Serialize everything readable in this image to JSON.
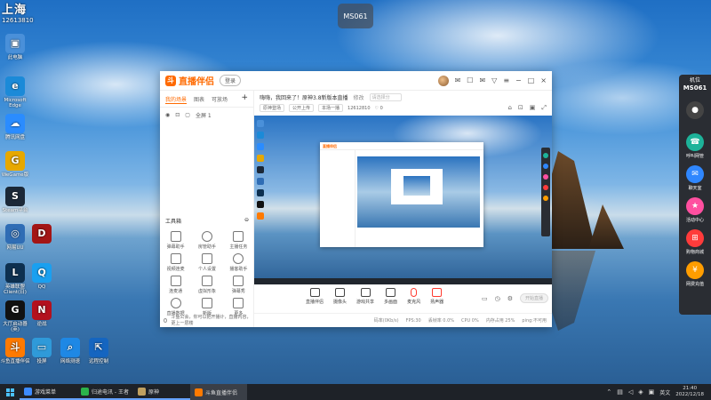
{
  "desktop": {
    "corner_label": "上海",
    "corner_sub": "12613810",
    "badge": "MS061",
    "icons": [
      {
        "label": "此电脑",
        "glyph": "▣",
        "color": "#4a90d9"
      },
      {
        "label": "Microsoft Edge",
        "glyph": "e",
        "color": "#1b8ad8"
      },
      {
        "label": "腾讯网盘",
        "glyph": "☁",
        "color": "#2a8cff"
      },
      {
        "label": "WeGame版",
        "glyph": "G",
        "color": "#e7a800"
      },
      {
        "label": "Steam平台",
        "glyph": "S",
        "color": "#1b2838"
      },
      {
        "label": "网易UU",
        "glyph": "◎",
        "color": "#2f6db5"
      },
      {
        "label": "",
        "glyph": "D",
        "color": "#a31515"
      },
      {
        "label": "英雄联盟 Client(日)",
        "glyph": "L",
        "color": "#0d3050"
      },
      {
        "label": "QQ",
        "glyph": "Q",
        "color": "#1aa0f0"
      },
      {
        "label": "大厅启动器 (英)",
        "glyph": "G",
        "color": "#111"
      },
      {
        "label": "逆战",
        "glyph": "N",
        "color": "#b3111e"
      },
      {
        "label": "斗鱼直播伴侣",
        "glyph": "斗",
        "color": "#ff7a00"
      },
      {
        "label": "投屏",
        "glyph": "▭",
        "color": "#2f9ad9"
      },
      {
        "label": "网络测速",
        "glyph": "⌕",
        "color": "#1e88e5"
      },
      {
        "label": "远程控制",
        "glyph": "⇱",
        "color": "#1565c0"
      }
    ]
  },
  "right_panel": {
    "title": "机位",
    "machine": "MS061",
    "items": [
      {
        "label": "",
        "glyph": "●",
        "color": "#444"
      },
      {
        "label": "呼叫网管",
        "glyph": "☎",
        "color": "#1db39a"
      },
      {
        "label": "聊天室",
        "glyph": "✉",
        "color": "#2f87ff"
      },
      {
        "label": "活动中心",
        "glyph": "★",
        "color": "#ff4fa0"
      },
      {
        "label": "购物商城",
        "glyph": "⊞",
        "color": "#ff3b3b"
      },
      {
        "label": "网费充值",
        "glyph": "¥",
        "color": "#ff9d00"
      }
    ]
  },
  "app": {
    "brand": "直播伴侣",
    "login_label": "登录",
    "sidebar_tabs": [
      "我的场景",
      "图表",
      "可放场"
    ],
    "add_label": "+",
    "scene_label": "全屏 1",
    "toolbox_label": "工具箱",
    "tools": [
      {
        "label": "弹幕助手"
      },
      {
        "label": "房管助手"
      },
      {
        "label": "主播任务"
      },
      {
        "label": "视频连麦"
      },
      {
        "label": "个人设置"
      },
      {
        "label": "播客助手"
      },
      {
        "label": "连麦通"
      },
      {
        "label": "虚拟形象"
      },
      {
        "label": "弹幕秀"
      },
      {
        "label": "直播数据"
      },
      {
        "label": "新版"
      },
      {
        "label": "更多"
      }
    ],
    "topic": "嗨嗨，我回来了！原神3.8新版本直播",
    "topic_tag": "修改",
    "topic_input_placeholder": "请选择分",
    "subrow": [
      "原神登场",
      "公开上传",
      "本场一播",
      "12612810"
    ],
    "subcounts": "♡ 0",
    "controls": [
      {
        "label": "直播伴侣"
      },
      {
        "label": "摄像头"
      },
      {
        "label": "游戏共享"
      },
      {
        "label": "多画面"
      },
      {
        "label": "麦克风"
      },
      {
        "label": "扬声器"
      }
    ],
    "go_live_label": "开始直播",
    "status_left": "斗鱼公会，你可以把开播计，直播内容，更上一层楼",
    "status_items": [
      "码率(0Kb/s)",
      "FPS:30",
      "丢帧率 0.0%",
      "CPU 0%",
      "内存占用 25%",
      "ping:不可用"
    ]
  },
  "taskbar": {
    "items": [
      {
        "label": "游戏菜单",
        "color": "#3d8bff",
        "state": "open"
      },
      {
        "label": "归途电讯 - 王者",
        "color": "#2bb34a",
        "state": "open"
      },
      {
        "label": "原神",
        "color": "#c0a060",
        "state": "open"
      },
      {
        "label": "斗鱼直播伴侣",
        "color": "#ff7a00",
        "state": "active"
      }
    ],
    "lang": "英文",
    "time": "21:40",
    "date": "2022/12/18"
  }
}
